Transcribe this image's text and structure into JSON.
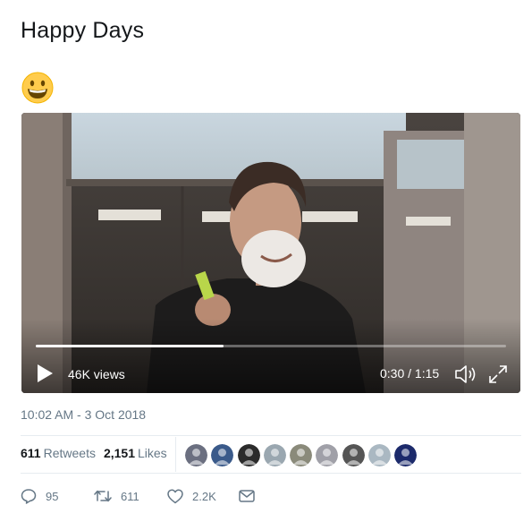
{
  "tweet": {
    "text": "Happy Days",
    "emoji": "grinning-face"
  },
  "video": {
    "views": "46K views",
    "time": "0:30 / 1:15",
    "progress": 0.4
  },
  "meta": {
    "timestamp": "10:02 AM - 3 Oct 2018"
  },
  "stats": {
    "retweets_count": "611",
    "retweets_label": "Retweets",
    "likes_count": "2,151",
    "likes_label": "Likes"
  },
  "avatar_colors": [
    "#6b6f80",
    "#3a5a8a",
    "#2b2b2b",
    "#9aa7b0",
    "#8a8a7a",
    "#a0a0a8",
    "#555555",
    "#aab8c2",
    "#1c2a6b"
  ],
  "actions": {
    "reply_count": "95",
    "retweet_count": "611",
    "like_count": "2.2K"
  },
  "colors": {
    "secondary_text": "#657786",
    "primary_text": "#14171a",
    "divider": "#e6ecf0"
  }
}
